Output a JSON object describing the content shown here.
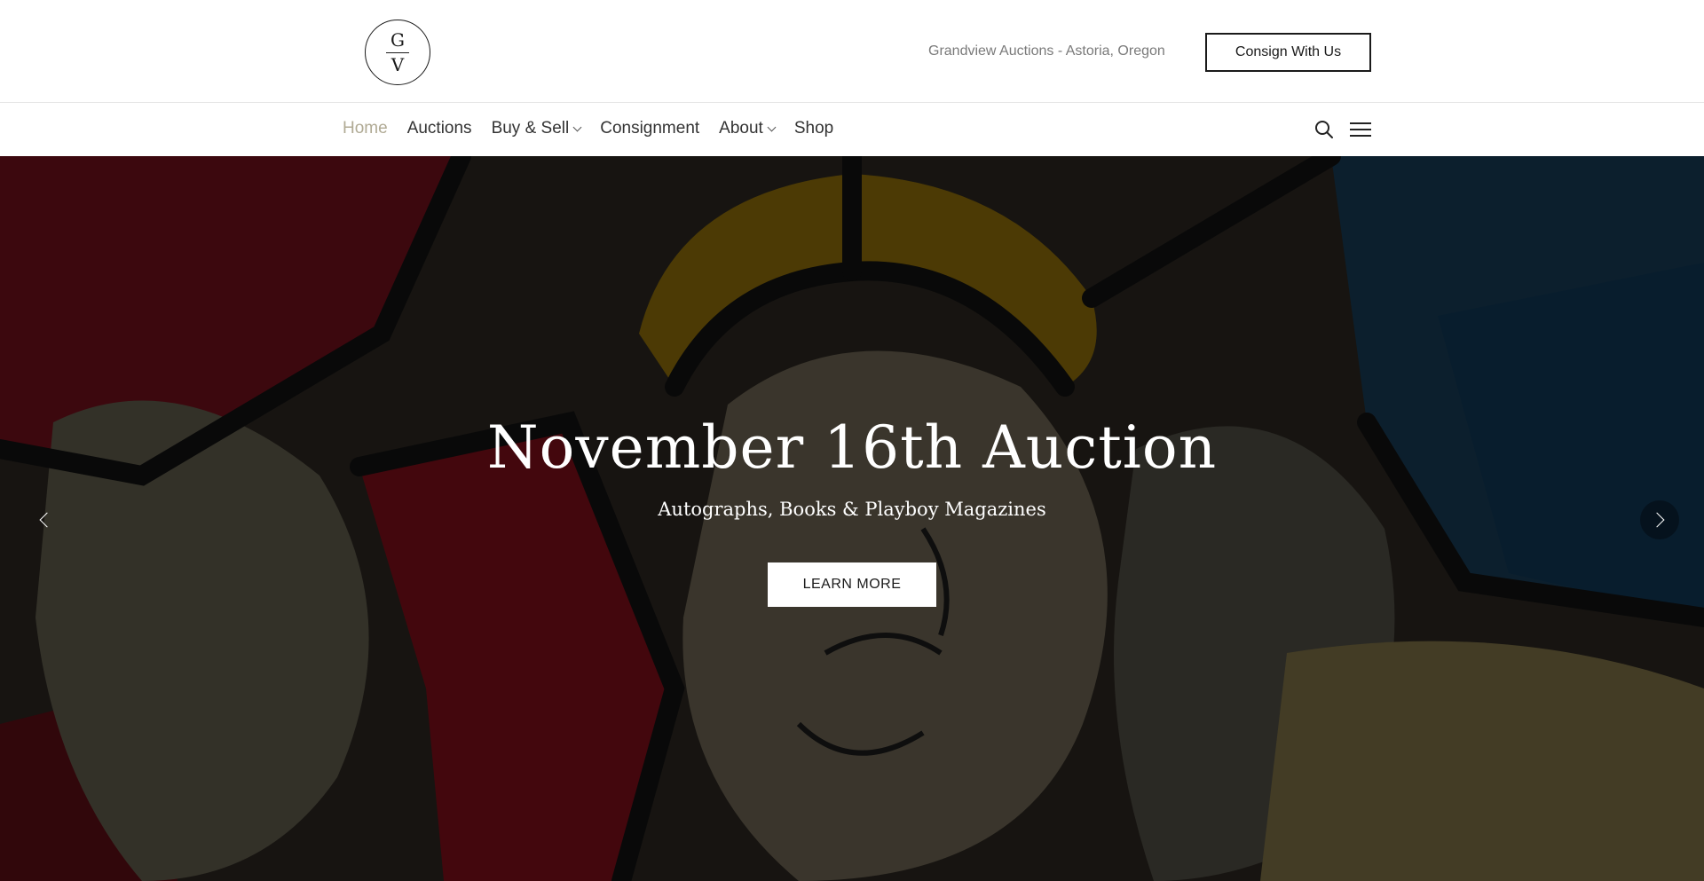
{
  "header": {
    "logo_top": "G",
    "logo_bottom": "V",
    "location": "Grandview Auctions - Astoria, Oregon",
    "consign_label": "Consign With Us"
  },
  "nav": {
    "items": [
      {
        "label": "Home",
        "active": true,
        "dropdown": false
      },
      {
        "label": "Auctions",
        "active": false,
        "dropdown": false
      },
      {
        "label": "Buy & Sell",
        "active": false,
        "dropdown": true
      },
      {
        "label": "Consignment",
        "active": false,
        "dropdown": false
      },
      {
        "label": "About",
        "active": false,
        "dropdown": true
      },
      {
        "label": "Shop",
        "active": false,
        "dropdown": false
      }
    ],
    "search_icon": "search-icon",
    "menu_icon": "hamburger-menu-icon"
  },
  "hero": {
    "title": "November 16th Auction",
    "subtitle": "Autographs, Books & Playboy Magazines",
    "button_label": "LEARN MORE",
    "prev_icon": "chevron-left-icon",
    "next_icon": "chevron-right-icon"
  },
  "colors": {
    "nav_active": "#b0aa94",
    "text_dark": "#1a1a1a",
    "muted": "#7a7a7a"
  }
}
